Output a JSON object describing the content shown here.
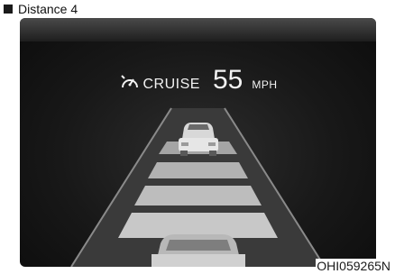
{
  "caption": {
    "label": "Distance 4"
  },
  "cluster": {
    "cruise_icon": "cruise-control-icon",
    "cruise_label": "CRUISE",
    "speed_value": "55",
    "speed_unit": "MPH",
    "distance_level": 4
  },
  "figure_code": "OHI059265N"
}
